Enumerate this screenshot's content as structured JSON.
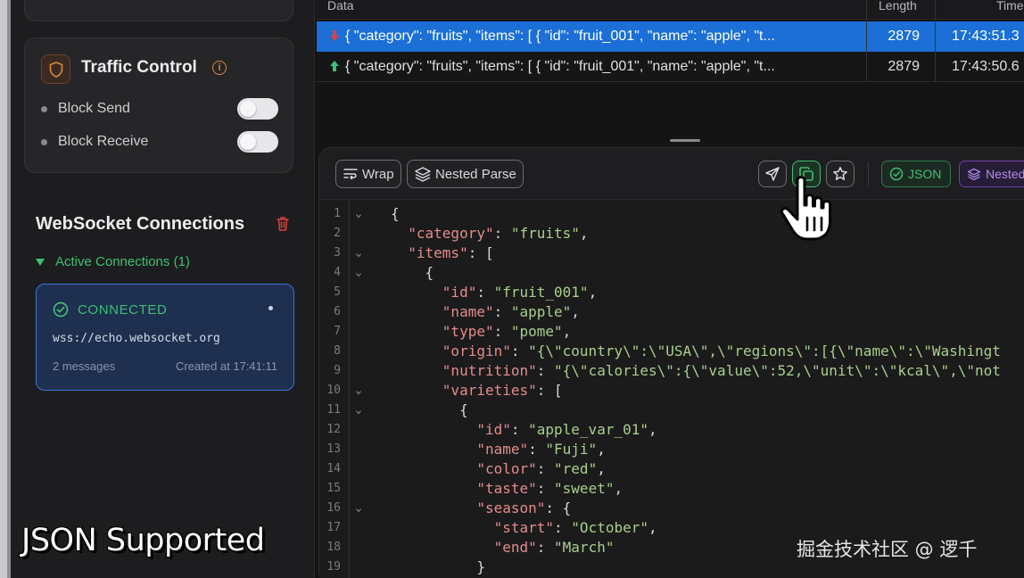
{
  "sidebar": {
    "traffic_control": {
      "title": "Traffic Control",
      "info_glyph": "i",
      "rows": [
        {
          "label": "Block Send",
          "enabled": false
        },
        {
          "label": "Block Receive",
          "enabled": false
        }
      ]
    },
    "websocket": {
      "title": "WebSocket Connections",
      "active_label": "Active Connections (1)",
      "connection": {
        "status": "CONNECTED",
        "url": "wss://echo.websocket.org",
        "messages": "2 messages",
        "created": "Created at 17:41:11"
      }
    }
  },
  "caption": "JSON Supported",
  "messages_table": {
    "columns": {
      "data": "Data",
      "length": "Length",
      "time": "Time"
    },
    "rows": [
      {
        "direction": "received",
        "data": "{ \"category\": \"fruits\", \"items\": [ { \"id\": \"fruit_001\", \"name\": \"apple\", \"t...",
        "length": "2879",
        "time": "17:43:51.3"
      },
      {
        "direction": "sent",
        "data": "{ \"category\": \"fruits\", \"items\": [ { \"id\": \"fruit_001\", \"name\": \"apple\", \"t...",
        "length": "2879",
        "time": "17:43:50.6"
      }
    ]
  },
  "toolbar": {
    "wrap_label": "Wrap",
    "nested_parse_label": "Nested Parse",
    "format_json_label": "JSON",
    "format_nested_label": "Nested"
  },
  "editor": {
    "lines": [
      {
        "num": "1",
        "fold": true
      },
      {
        "num": "2",
        "fold": false
      },
      {
        "num": "3",
        "fold": true
      },
      {
        "num": "4",
        "fold": true
      },
      {
        "num": "5",
        "fold": false
      },
      {
        "num": "6",
        "fold": false
      },
      {
        "num": "7",
        "fold": false
      },
      {
        "num": "8",
        "fold": false
      },
      {
        "num": "9",
        "fold": false
      },
      {
        "num": "10",
        "fold": true
      },
      {
        "num": "11",
        "fold": true
      },
      {
        "num": "12",
        "fold": false
      },
      {
        "num": "13",
        "fold": false
      },
      {
        "num": "14",
        "fold": false
      },
      {
        "num": "15",
        "fold": false
      },
      {
        "num": "16",
        "fold": true
      },
      {
        "num": "17",
        "fold": false
      },
      {
        "num": "18",
        "fold": false
      },
      {
        "num": "19",
        "fold": false
      }
    ],
    "code": {
      "l1": "{",
      "l2_key": "\"category\"",
      "l2_val": "\"fruits\"",
      "l3_key": "\"items\"",
      "l3_rest": ": [",
      "l4": "{",
      "l5_key": "\"id\"",
      "l5_val": "\"fruit_001\"",
      "l6_key": "\"name\"",
      "l6_val": "\"apple\"",
      "l7_key": "\"type\"",
      "l7_val": "\"pome\"",
      "l8_key": "\"origin\"",
      "l8_val": "\"{\\\"country\\\":\\\"USA\\\",\\\"regions\\\":[{\\\"name\\\":\\\"Washingt",
      "l9_key": "\"nutrition\"",
      "l9_val": "\"{\\\"calories\\\":{\\\"value\\\":52,\\\"unit\\\":\\\"kcal\\\",\\\"not",
      "l10_key": "\"varieties\"",
      "l10_rest": ": [",
      "l11": "{",
      "l12_key": "\"id\"",
      "l12_val": "\"apple_var_01\"",
      "l13_key": "\"name\"",
      "l13_val": "\"Fuji\"",
      "l14_key": "\"color\"",
      "l14_val": "\"red\"",
      "l15_key": "\"taste\"",
      "l15_val": "\"sweet\"",
      "l16_key": "\"season\"",
      "l16_rest": ": {",
      "l17_key": "\"start\"",
      "l17_val": "\"October\"",
      "l18_key": "\"end\"",
      "l18_val": "\"March\"",
      "l19": "}"
    }
  },
  "watermark": "掘金技术社区 @ 逻千",
  "colors": {
    "accent_blue": "#1b6fd6",
    "connected_green": "#3fbf73",
    "json_key": "#e58b8b",
    "json_string": "#a9cf8a",
    "nested_purple": "#b48cf0",
    "received_arrow": "#e0413e",
    "sent_arrow": "#3fbf73"
  },
  "icons": [
    "shield-icon",
    "info-icon",
    "trash-icon",
    "check-circle-icon",
    "arrow-down-icon",
    "arrow-up-icon",
    "wrap-icon",
    "layers-icon",
    "send-icon",
    "copy-icon",
    "star-icon",
    "hand-cursor-icon"
  ]
}
